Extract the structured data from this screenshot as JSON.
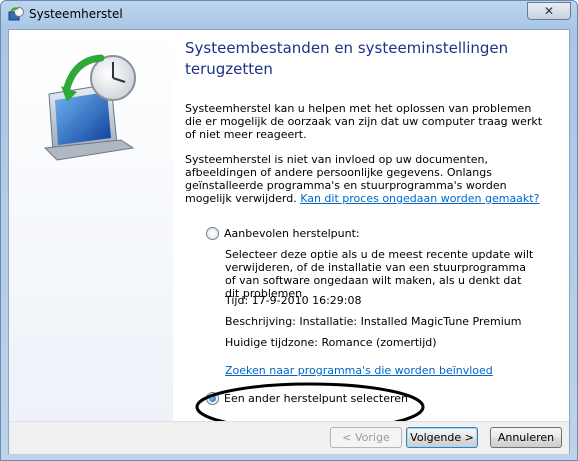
{
  "window": {
    "title": "Systeemherstel",
    "close_symbol": "✕"
  },
  "main": {
    "heading": "Systeembestanden en systeeminstellingen terugzetten",
    "paragraph1": "Systeemherstel kan u helpen met het oplossen van problemen die er mogelijk de oorzaak van zijn dat uw computer traag werkt of niet meer reageert.",
    "paragraph2": "Systeemherstel is niet van invloed op uw documenten, afbeeldingen of andere persoonlijke gegevens. Onlangs geïnstalleerde programma's en stuurprogramma's worden mogelijk verwijderd.",
    "undo_link": "Kan dit proces ongedaan worden gemaakt?",
    "option_recommended": {
      "label": "Aanbevolen herstelpunt:",
      "selected": false,
      "description": "Selecteer deze optie als u de meest recente update wilt verwijderen, of de installatie van een stuurprogramma of van software ongedaan wilt maken, als u denkt dat dit problemen",
      "time": "Tijd: 17-9-2010 16:29:08",
      "description_line": "Beschrijving: Installatie: Installed MagicTune Premium",
      "timezone": "Huidige tijdzone: Romance (zomertijd)"
    },
    "programs_link": "Zoeken naar programma's die worden beïnvloed",
    "option_other": {
      "label": "Een ander herstelpunt selecteren",
      "selected": true
    }
  },
  "footer": {
    "back": "< Vorige",
    "next": "Volgende >",
    "cancel": "Annuleren"
  },
  "colors": {
    "heading": "#1e3287",
    "link": "#0066cc",
    "annotation": "#000000"
  }
}
